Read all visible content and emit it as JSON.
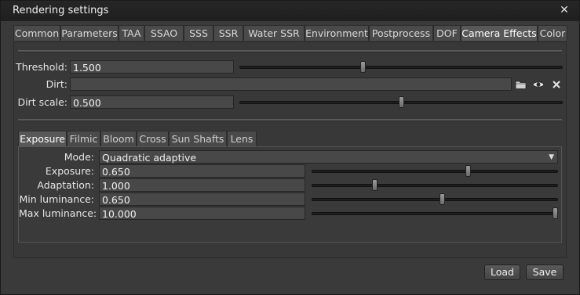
{
  "window": {
    "title": "Rendering settings",
    "close_glyph": "✕"
  },
  "tabs": [
    {
      "label": "Common"
    },
    {
      "label": "Parameters"
    },
    {
      "label": "TAA"
    },
    {
      "label": "SSAO"
    },
    {
      "label": "SSS"
    },
    {
      "label": "SSR"
    },
    {
      "label": "Water SSR"
    },
    {
      "label": "Environment"
    },
    {
      "label": "Postprocess"
    },
    {
      "label": "DOF"
    },
    {
      "label": "Camera Effects",
      "active": true
    },
    {
      "label": "Color"
    }
  ],
  "camera_effects": {
    "threshold": {
      "label": "Threshold:",
      "value": "1.500",
      "slider_fraction": 0.38
    },
    "dirt": {
      "label": "Dirt:",
      "value": ""
    },
    "dirt_scale": {
      "label": "Dirt scale:",
      "value": "0.500",
      "slider_fraction": 0.5
    },
    "icons": {
      "folder": "folder-icon",
      "eye": "eye-icon",
      "clear": "clear-icon"
    }
  },
  "subtabs": [
    {
      "label": "Exposure",
      "active": true
    },
    {
      "label": "Filmic"
    },
    {
      "label": "Bloom"
    },
    {
      "label": "Cross"
    },
    {
      "label": "Sun Shafts"
    },
    {
      "label": "Lens"
    }
  ],
  "exposure": {
    "mode": {
      "label": "Mode:",
      "value": "Quadratic adaptive"
    },
    "exposure": {
      "label": "Exposure:",
      "value": "0.650",
      "slider_fraction": 0.64
    },
    "adaptation": {
      "label": "Adaptation:",
      "value": "1.000",
      "slider_fraction": 0.25
    },
    "min_luminance": {
      "label": "Min luminance:",
      "value": "0.650",
      "slider_fraction": 0.53
    },
    "max_luminance": {
      "label": "Max luminance:",
      "value": "10.000",
      "slider_fraction": 1.0
    }
  },
  "footer": {
    "load_label": "Load",
    "save_label": "Save"
  }
}
